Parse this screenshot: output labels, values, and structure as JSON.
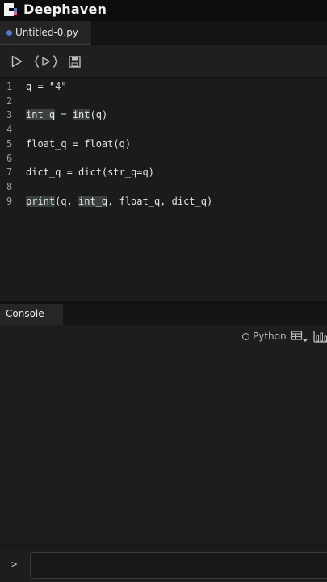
{
  "app": {
    "title": "Deephaven"
  },
  "tab": {
    "label": "Untitled-0.py",
    "dot_color": "#4e7bd6"
  },
  "toolbar": {
    "run_icon": "play-icon",
    "run_selection_icon": "run-selection-icon",
    "save_icon": "save-icon"
  },
  "editor": {
    "lines": [
      {
        "num": "1",
        "tokens": [
          {
            "t": "q = "
          },
          {
            "t": "\"4\"",
            "c": "str"
          }
        ]
      },
      {
        "num": "2",
        "tokens": []
      },
      {
        "num": "3",
        "tokens": [
          {
            "t": "int_q",
            "c": "hl"
          },
          {
            "t": " = "
          },
          {
            "t": "int",
            "c": "hl"
          },
          {
            "t": "(q)"
          }
        ]
      },
      {
        "num": "4",
        "tokens": []
      },
      {
        "num": "5",
        "tokens": [
          {
            "t": "float_q = float(q)"
          }
        ]
      },
      {
        "num": "6",
        "tokens": []
      },
      {
        "num": "7",
        "tokens": [
          {
            "t": "dict_q = dict(str_q=q)"
          }
        ]
      },
      {
        "num": "8",
        "tokens": []
      },
      {
        "num": "9",
        "tokens": [
          {
            "t": "print",
            "c": "hl"
          },
          {
            "t": "(q, "
          },
          {
            "t": "int_q",
            "c": "hl"
          },
          {
            "t": ", float_q, dict_q)"
          }
        ]
      }
    ]
  },
  "console": {
    "tab_label": "Console",
    "language": "Python",
    "prompt": ">",
    "input_value": ""
  }
}
